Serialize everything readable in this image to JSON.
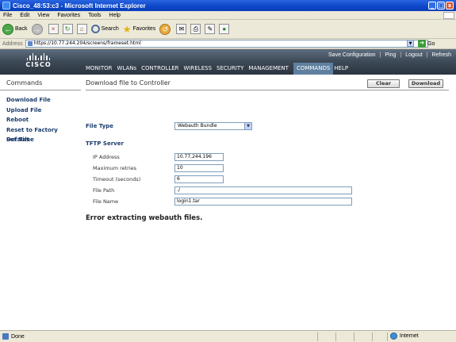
{
  "window": {
    "title": "Cisco_48:53:c3 - Microsoft Internet Explorer",
    "minimize": "_",
    "maximize": "□",
    "close": "x"
  },
  "menu": [
    "File",
    "Edit",
    "View",
    "Favorites",
    "Tools",
    "Help"
  ],
  "toolbar": {
    "back": "Back",
    "search": "Search",
    "favorites": "Favorites"
  },
  "address": {
    "label": "Address",
    "url": "https://10.77.244.204/screens/frameset.html",
    "go": "Go"
  },
  "header": {
    "logo_text": "CISCO",
    "top_links": [
      "Save Configuration",
      "Ping",
      "Logout",
      "Refresh"
    ],
    "nav": [
      "MONITOR",
      "WLANs",
      "CONTROLLER",
      "WIRELESS",
      "SECURITY",
      "MANAGEMENT",
      "COMMANDS",
      "HELP"
    ],
    "active_nav": "COMMANDS"
  },
  "sidebar": {
    "title": "Commands",
    "items": [
      "Download File",
      "Upload File",
      "Reboot",
      "Reset to Factory Default",
      "Set Time"
    ]
  },
  "main": {
    "title": "Download file to Controller",
    "clear_label": "Clear",
    "download_label": "Download",
    "file_type_label": "File Type",
    "file_type_value": "Webauth Bundle",
    "tftp_title": "TFTP Server",
    "fields": [
      {
        "label": "IP Address",
        "value": "10.77.244.196"
      },
      {
        "label": "Maximum retries",
        "value": "10"
      },
      {
        "label": "Timeout (seconds)",
        "value": "6"
      },
      {
        "label": "File Path",
        "value": "./"
      },
      {
        "label": "File Name",
        "value": "login1.tar"
      }
    ],
    "error": "Error extracting webauth files."
  },
  "status": {
    "left": "Done",
    "zone": "Internet"
  }
}
